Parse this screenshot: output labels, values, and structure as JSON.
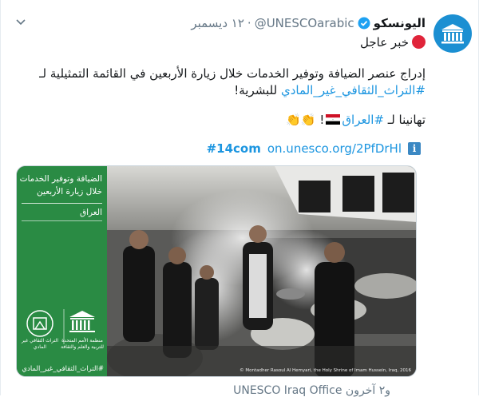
{
  "tweet": {
    "display_name": "اليونسكو",
    "handle": "@UNESCOarabic",
    "dot": "·",
    "date": "١٢ ديسمبر",
    "line1": "خبر عاجل",
    "body_line1": "إدراج عنصر الضيافة وتوفير الخدمات خلال زيارة الأربعين في القائمة التمثيلية لـ",
    "body_hashtag": "#التراث_الثقافي_غير_المادي",
    "body_line2_rest": " للبشرية!",
    "congrats_prefix": "تهانينا لـ ",
    "congrats_hashtag": "#العراق",
    "congrats_suffix": "!",
    "claps": "👏👏",
    "link_url": "on.unesco.org/2PfDrHl",
    "link_hashtag": "#14com",
    "info_glyph": "i"
  },
  "media": {
    "overlay_title_1": "الضيافة وتوفير الخدمات",
    "overlay_title_2": "خلال زيارة الأربعين",
    "overlay_country": "العراق",
    "ich_label": "التراث الثقافي غير المادي",
    "un_label": "منظمة الأمم المتحدة للتربية والعلم والثقافة",
    "overlay_hashtag": "#التراث_الثقافي_غير_المادي",
    "credit": "© Montadher Rasoul Al Hemyari, the Holy Shrine of Imam Hussein, Iraq, 2016"
  },
  "footer": {
    "text": "و٢ آخرون UNESCO Iraq Office"
  },
  "icons": {
    "avatar": "unesco-temple-icon",
    "verified": "verified-badge-icon",
    "menu": "chevron-down-icon",
    "breaking": "red-circle-icon",
    "flag": "iraq-flag-icon",
    "info": "info-icon"
  },
  "colors": {
    "link": "#1b95e0",
    "secondary": "#657786",
    "avatar_bg": "#1b8fd2",
    "overlay_green": "#289646",
    "breaking_red": "#e0243a"
  }
}
